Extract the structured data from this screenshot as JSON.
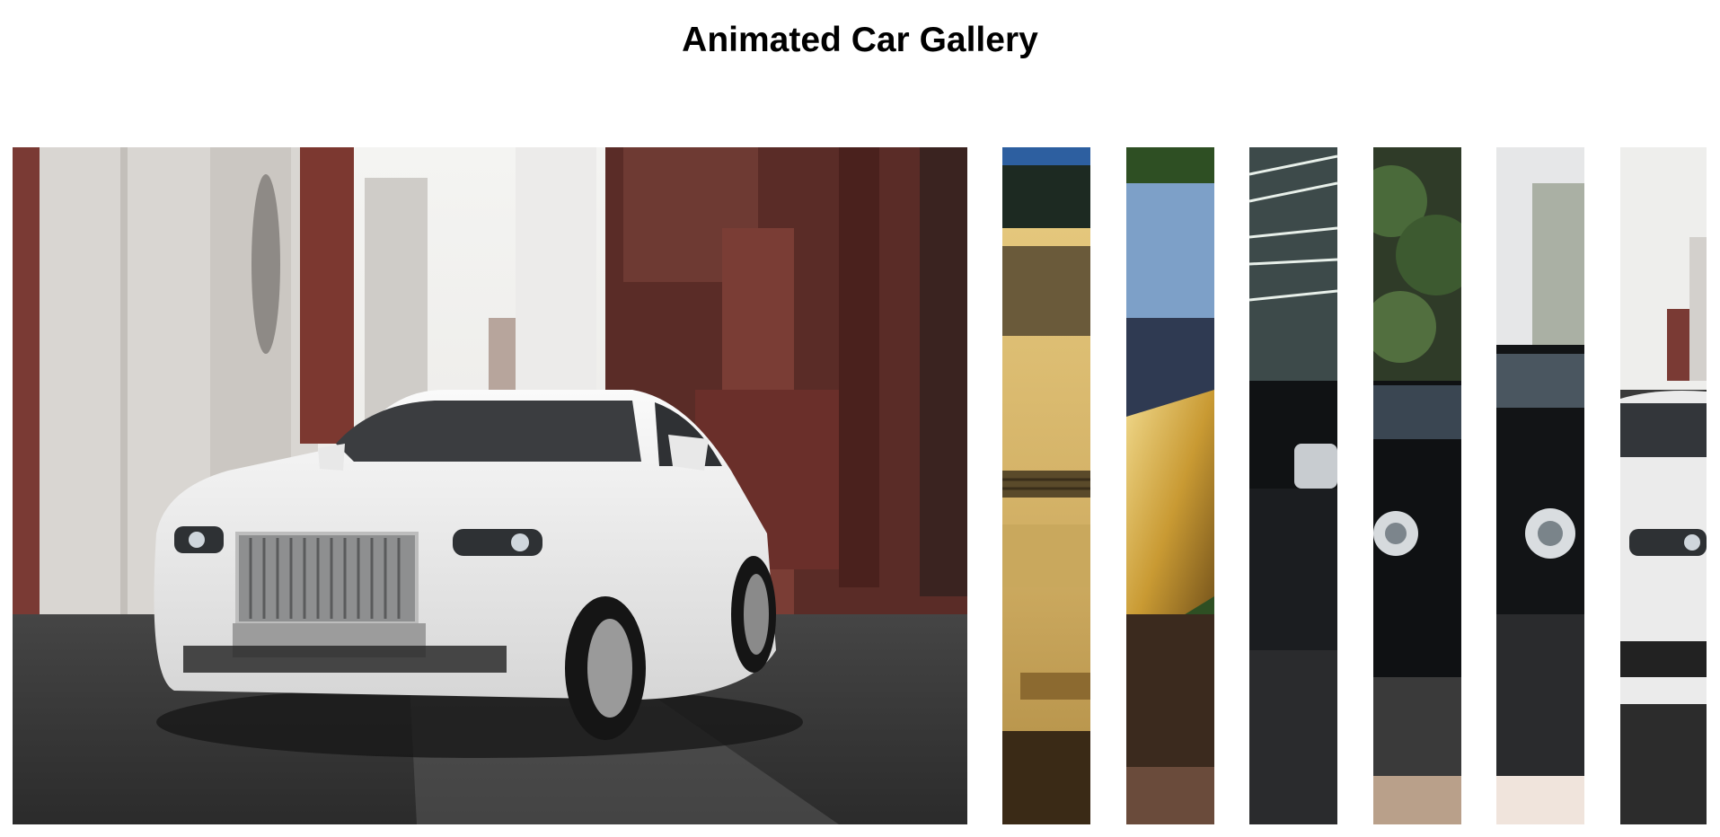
{
  "page": {
    "title": "Animated Car Gallery"
  },
  "gallery": {
    "panels": [
      {
        "name": "white-rolls-royce-ghost",
        "state": "expanded"
      },
      {
        "name": "gold-rolls-royce",
        "state": "collapsed"
      },
      {
        "name": "gold-wrapped-car",
        "state": "collapsed"
      },
      {
        "name": "black-rolls-royce",
        "state": "collapsed"
      },
      {
        "name": "black-bentley-continental",
        "state": "collapsed"
      },
      {
        "name": "black-bentley-convertible",
        "state": "collapsed"
      },
      {
        "name": "white-rolls-royce-repeat",
        "state": "collapsed"
      }
    ]
  },
  "colors": {
    "background": "#ffffff",
    "title": "#000000"
  }
}
